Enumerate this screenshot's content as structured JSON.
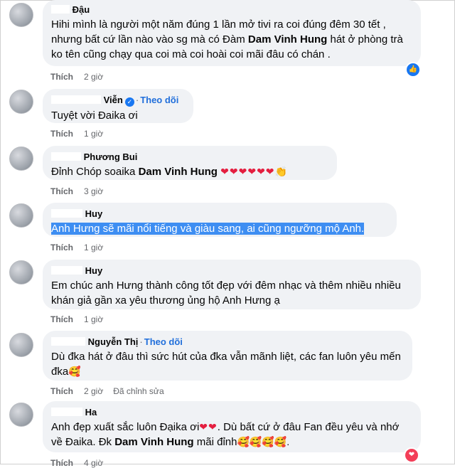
{
  "actions": {
    "like_label": "Thích"
  },
  "comments": [
    {
      "author_suffix": "Đậu",
      "text": "Hihi mình là người một năm đúng 1 lần mở tivi ra coi đúng đêm 30 tết , nhưng bất cứ lần nào vào sg mà có Đàm ",
      "tag": "Dam Vinh Hung",
      "text_after": " hát ở phòng trà ko tên cũng chạy qua coi mà coi hoài coi mãi đâu có chán .",
      "time": "2 giờ",
      "reaction": "like"
    },
    {
      "author_suffix": "Viễn",
      "follow": "Theo dõi",
      "text": "Tuyệt vời Đaika ơi",
      "time": "1 giờ"
    },
    {
      "author_suffix": "Phương Bui",
      "text": "Đỉnh Chóp soaika ",
      "tag": "Dam Vinh Hung",
      "hearts": "❤❤❤❤❤❤",
      "clap": "👏",
      "time": "3 giờ"
    },
    {
      "author_suffix": "Huy",
      "text": "Anh Hưng sẽ mãi nổi tiếng và giàu sang, ai cũng ngưỡng mộ Anh.",
      "time": "1 giờ"
    },
    {
      "author_suffix": "Huy",
      "text": "Em chúc anh Hưng thành công tốt đẹp với đêm nhạc và thêm nhiều nhiều khán giả gần xa yêu thương ủng hộ Anh Hưng ạ",
      "time": "1 giờ"
    },
    {
      "author_suffix": "Nguyễn Thị",
      "follow": "Theo dõi",
      "text": "Dù đka hát ở đâu thì sức hút của đka vẫn mãnh liệt, các fan luôn yêu mến đka",
      "emoji": "🥰",
      "time": "2 giờ",
      "edited": "Đã chỉnh sửa"
    },
    {
      "author_suffix": "Ha",
      "text": "Anh đẹp xuất sắc luôn Đạika ơi",
      "hearts": "❤❤",
      "text_mid": ". Dù bất cứ ở đâu Fan đều yêu và nhớ về Đaika. Đk ",
      "tag": "Dam Vinh Hung",
      "text_end": " mãi đỉnh",
      "emojis": "🥰🥰🥰🥰.",
      "time": "4 giờ",
      "reaction": "love"
    }
  ]
}
